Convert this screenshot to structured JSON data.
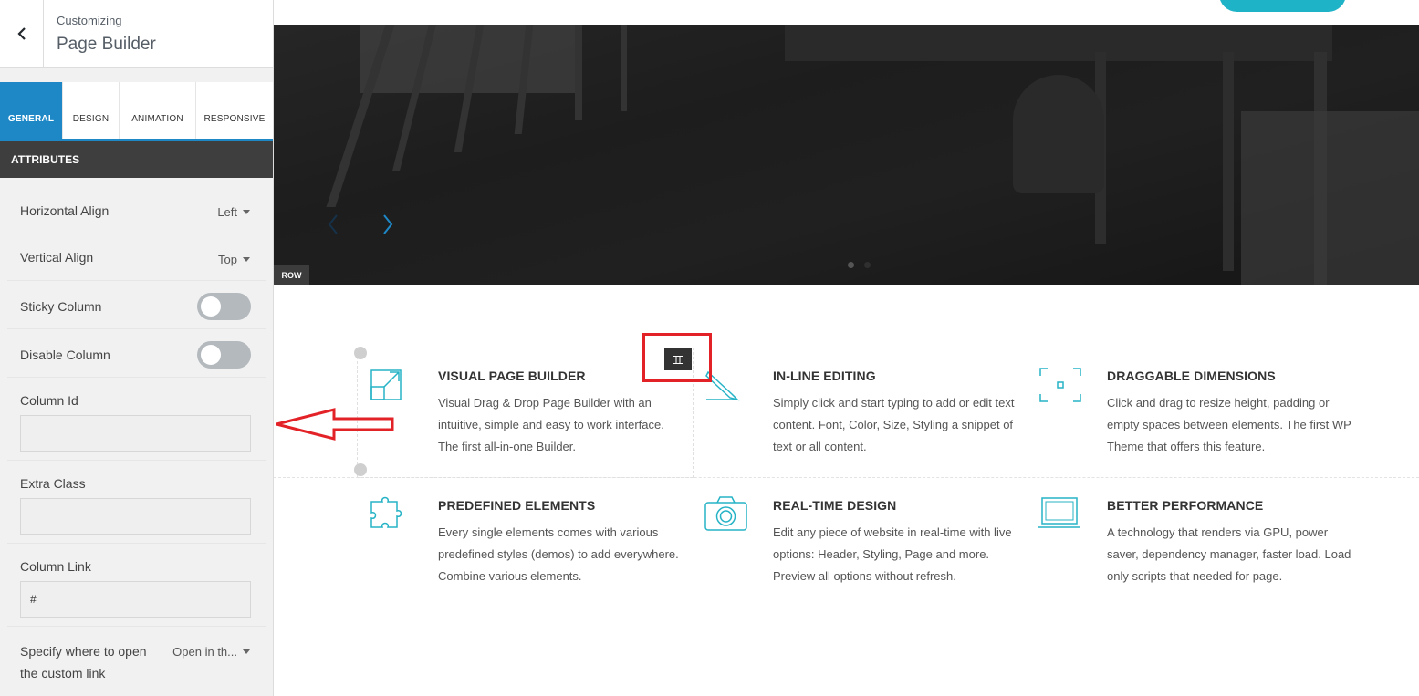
{
  "customizer": {
    "subtitle": "Customizing",
    "title": "Page Builder"
  },
  "tabs": [
    {
      "label": "GENERAL",
      "active": true
    },
    {
      "label": "DESIGN",
      "active": false
    },
    {
      "label": "ANIMATION",
      "active": false
    },
    {
      "label": "RESPONSIVE",
      "active": false
    }
  ],
  "attributes": {
    "header": "ATTRIBUTES",
    "horizontal_align": {
      "label": "Horizontal Align",
      "value": "Left"
    },
    "vertical_align": {
      "label": "Vertical Align",
      "value": "Top"
    },
    "sticky_column": {
      "label": "Sticky Column",
      "on": false
    },
    "disable_column": {
      "label": "Disable Column",
      "on": false
    },
    "column_id": {
      "label": "Column Id",
      "value": ""
    },
    "extra_class": {
      "label": "Extra Class",
      "value": ""
    },
    "column_link": {
      "label": "Column Link",
      "value": "#"
    },
    "link_target": {
      "label": "Specify where to open the custom link",
      "value": "Open in th..."
    }
  },
  "preview": {
    "row_badge": "ROW",
    "slider_dots": 2,
    "active_dot": 1
  },
  "features": [
    {
      "icon": "external-link-icon",
      "title": "VISUAL PAGE BUILDER",
      "desc": "Visual Drag & Drop Page Builder with an intuitive, simple and easy to work interface. The first all-in-one Builder."
    },
    {
      "icon": "pencil-icon",
      "title": "IN-LINE EDITING",
      "desc": "Simply click  and start typing to add or edit text content. Font, Color, Size, Styling a snippet of text or all content."
    },
    {
      "icon": "resize-frame-icon",
      "title": "DRAGGABLE DIMENSIONS",
      "desc": "Click and drag to resize height, padding or empty spaces between elements. The first WP Theme that offers this feature."
    },
    {
      "icon": "puzzle-icon",
      "title": "PREDEFINED ELEMENTS",
      "desc": "Every single elements comes with various predefined styles (demos) to add everywhere. Combine various elements."
    },
    {
      "icon": "camera-icon",
      "title": "REAL-TIME DESIGN",
      "desc": "Edit any piece of website in real-time with live options: Header, Styling, Page and more. Preview all options without refresh."
    },
    {
      "icon": "laptop-icon",
      "title": "BETTER PERFORMANCE",
      "desc": "A technology that renders via GPU, power saver, dependency manager, faster load. Load only scripts that needed for page."
    }
  ],
  "colors": {
    "accent": "#1e88c7",
    "icon": "#26b3c6",
    "annotation": "#e32227"
  }
}
